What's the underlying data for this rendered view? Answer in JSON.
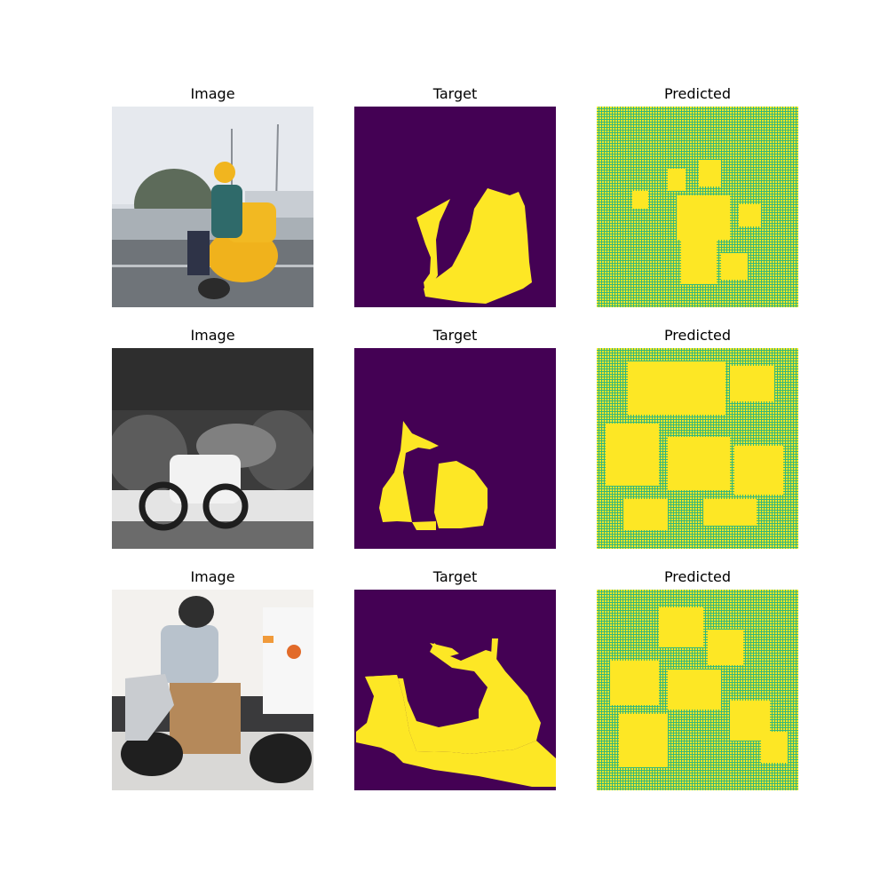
{
  "figure": {
    "rows": [
      {
        "image_title": "Image",
        "target_title": "Target",
        "predicted_title": "Predicted"
      },
      {
        "image_title": "Image",
        "target_title": "Target",
        "predicted_title": "Predicted"
      },
      {
        "image_title": "Image",
        "target_title": "Target",
        "predicted_title": "Predicted"
      }
    ]
  },
  "colors": {
    "mask_background": "#440154",
    "mask_foreground": "#fde725",
    "pred_green": "#35b779",
    "pred_yellow": "#fde725"
  },
  "image_subjects": [
    "rider on yellow touring motorcycle on highway",
    "black and white photo of motorbike loaded with bicycles",
    "man on scooter carrying cardboard boxes"
  ]
}
